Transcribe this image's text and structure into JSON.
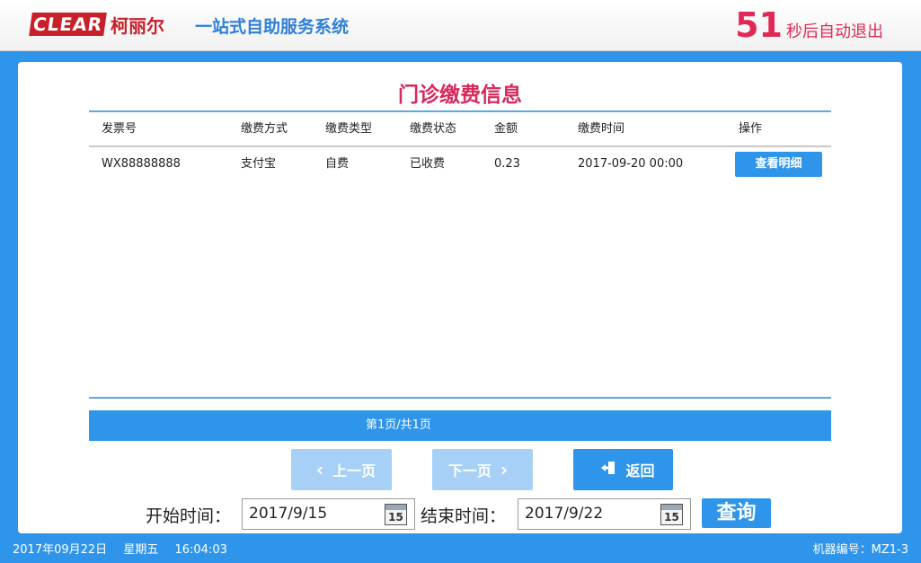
{
  "header": {
    "logo_text": "CLEAR",
    "logo_cn": "柯丽尔",
    "app_title": "一站式自助服务系统",
    "countdown_value": "51",
    "countdown_text": "秒后自动退出"
  },
  "panel": {
    "title": "门诊缴费信息",
    "columns": [
      "发票号",
      "缴费方式",
      "缴费类型",
      "缴费状态",
      "金额",
      "缴费时间",
      "操作"
    ],
    "rows": [
      {
        "invoice_no": "WX88888888",
        "pay_method": "支付宝",
        "pay_type": "自费",
        "pay_status": "已收费",
        "amount": "0.23",
        "pay_time": "2017-09-20 00:00",
        "action_label": "查看明细"
      }
    ],
    "pager_text": "第1页/共1页"
  },
  "nav": {
    "prev_label": "上一页",
    "next_label": "下一页",
    "back_label": "返回",
    "prev_icon": "chevron-left-icon",
    "next_icon": "chevron-right-icon",
    "back_icon": "exit-door-icon"
  },
  "filter": {
    "start_label": "开始时间：",
    "start_value": "2017/9/15",
    "end_label": "结束时间：",
    "end_value": "2017/9/22",
    "calendar_day": "15",
    "query_label": "查询"
  },
  "status": {
    "date": "2017年09月22日",
    "weekday": "星期五",
    "time": "16:04:03",
    "machine": "机器编号：MZ1-3"
  },
  "colors": {
    "primary": "#2f95ea",
    "accent": "#d62a5c",
    "disabled": "#a6d0f5"
  }
}
